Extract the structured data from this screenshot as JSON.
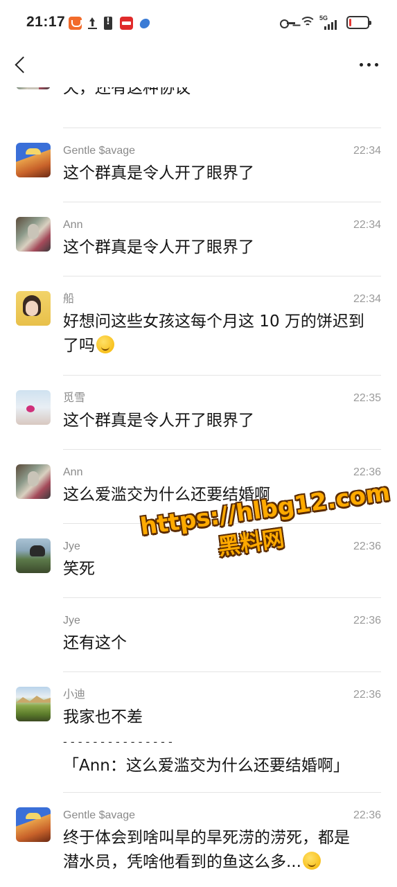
{
  "status_bar": {
    "time": "21:17",
    "network": "5G",
    "battery_level": 0.1
  },
  "nav": {
    "back_icon": "chevron-left-icon",
    "more_icon": "more-dots-icon"
  },
  "messages": [
    {
      "name": "",
      "time": "",
      "text": "天，还有这种协议",
      "avatar": "ann"
    },
    {
      "name": "Gentle $avage",
      "time": "22:34",
      "text": "这个群真是令人开了眼界了",
      "avatar": "gentle"
    },
    {
      "name": "Ann",
      "time": "22:34",
      "text": "这个群真是令人开了眼界了",
      "avatar": "ann"
    },
    {
      "name": "船",
      "time": "22:34",
      "text_line1": "好想问这些女孩这每个月这 10 万的饼迟到",
      "text_line2": "了吗",
      "avatar": "chuan",
      "emoji": "laugh-cry-emoji"
    },
    {
      "name": "觅雪",
      "time": "22:35",
      "text": "这个群真是令人开了眼界了",
      "avatar": "mixue"
    },
    {
      "name": "Ann",
      "time": "22:36",
      "text": "这么爱滥交为什么还要结婚啊",
      "avatar": "ann"
    },
    {
      "name": "Jye",
      "time": "22:36",
      "text": "笑死",
      "avatar": "jye"
    },
    {
      "name": "Jye",
      "time": "22:36",
      "text": "还有这个",
      "avatar": ""
    },
    {
      "name": "小迪",
      "time": "22:36",
      "text": "我家也不差",
      "separator": "- - - - - - - - - - - - - - -",
      "quote": "「Ann：这么爱滥交为什么还要结婚啊」",
      "avatar": "xiaodi"
    },
    {
      "name": "Gentle $avage",
      "time": "22:36",
      "text_line1": "终于体会到啥叫旱的旱死涝的涝死，都是",
      "text_line2": "潜水员，凭啥他看到的鱼这么多...",
      "avatar": "gentle",
      "emoji": "frown-emoji"
    }
  ],
  "watermark": {
    "url": "https://hlbg12.com",
    "name": "黑料网"
  },
  "colors": {
    "text": "#151515",
    "meta": "#8a8a8a",
    "watermark": "#ffaa00"
  }
}
